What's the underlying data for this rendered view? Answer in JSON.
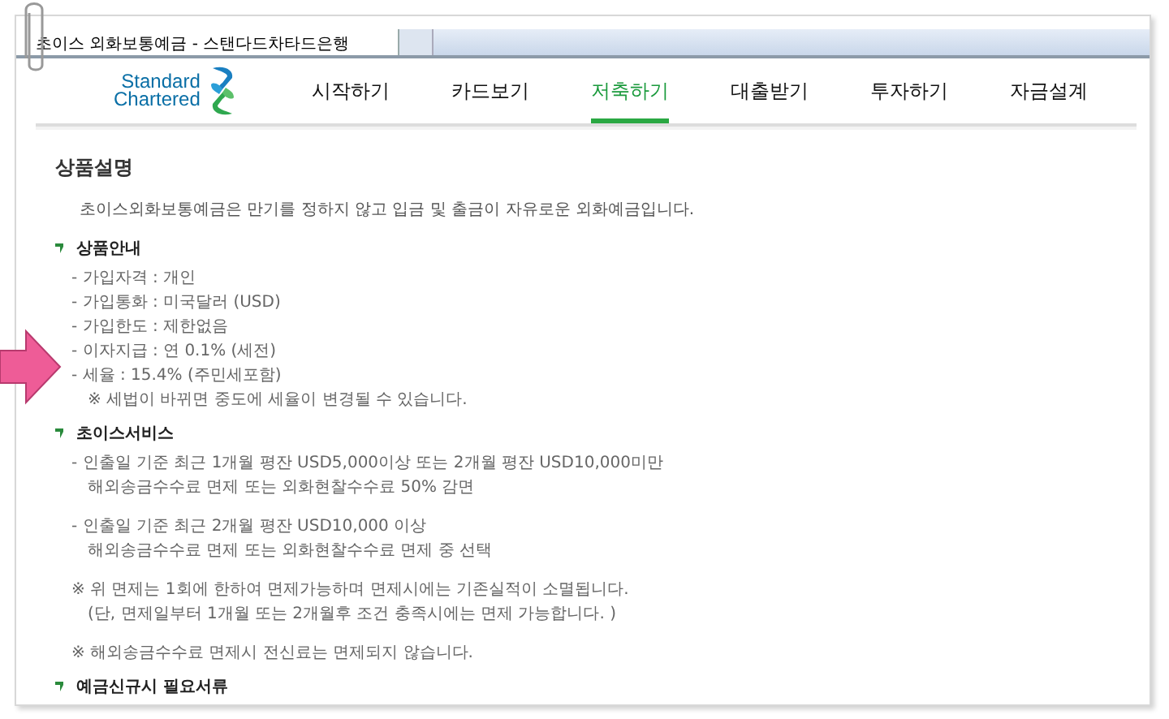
{
  "browser_tab": {
    "title": "초이스 외화보통예금 - 스탠다드차타드은행"
  },
  "logo": {
    "line_1": "Standard",
    "line_2": "Chartered"
  },
  "nav": [
    {
      "label": "시작하기",
      "selected": false
    },
    {
      "label": "카드보기",
      "selected": false
    },
    {
      "label": "저축하기",
      "selected": true
    },
    {
      "label": "대출받기",
      "selected": false
    },
    {
      "label": "투자하기",
      "selected": false
    },
    {
      "label": "자금설계",
      "selected": false
    }
  ],
  "section_title": "상품설명",
  "intro": "초이스외화보통예금은 만기를 정하지 않고 입금 및 출금이 자유로운 외화예금입니다.",
  "sections": [
    {
      "title": "상품안내",
      "items": [
        {
          "kind": "dash",
          "lines": [
            "- 가입자격 : 개인"
          ]
        },
        {
          "kind": "dash",
          "lines": [
            "- 가입통화 : 미국달러 (USD)"
          ]
        },
        {
          "kind": "dash",
          "lines": [
            "- 가입한도 : 제한없음"
          ]
        },
        {
          "kind": "dash",
          "lines": [
            "- 이자지급 : 연 0.1% (세전)"
          ]
        },
        {
          "kind": "dash",
          "lines": [
            "- 세율 : 15.4% (주민세포함)"
          ]
        },
        {
          "kind": "note",
          "lines": [
            "※ 세법이 바뀌면 중도에 세율이 변경될 수 있습니다."
          ]
        }
      ]
    },
    {
      "title": "초이스서비스",
      "items": [
        {
          "kind": "dash",
          "lines": [
            "- 인출일 기준 최근 1개월 평잔 USD5,000이상 또는 2개월 평잔 USD10,000미만",
            "해외송금수수료 면제 또는 외화현찰수수료 50% 감면"
          ]
        },
        {
          "kind": "dash",
          "lines": [
            "- 인출일 기준 최근 2개월 평잔 USD10,000 이상",
            "해외송금수수료 면제 또는 외화현찰수수료 면제 중 선택"
          ]
        },
        {
          "kind": "note",
          "lines": [
            "※ 위 면제는 1회에 한하여 면제가능하며 면제시에는 기존실적이 소멸됩니다.",
            "(단, 면제일부터 1개월 또는 2개월후 조건 충족시에는 면제 가능합니다. )"
          ]
        },
        {
          "kind": "note",
          "lines": [
            "※ 해외송금수수료 면제시 전신료는 면제되지 않습니다."
          ]
        }
      ]
    },
    {
      "title": "예금신규시 필요서류"
    }
  ]
}
